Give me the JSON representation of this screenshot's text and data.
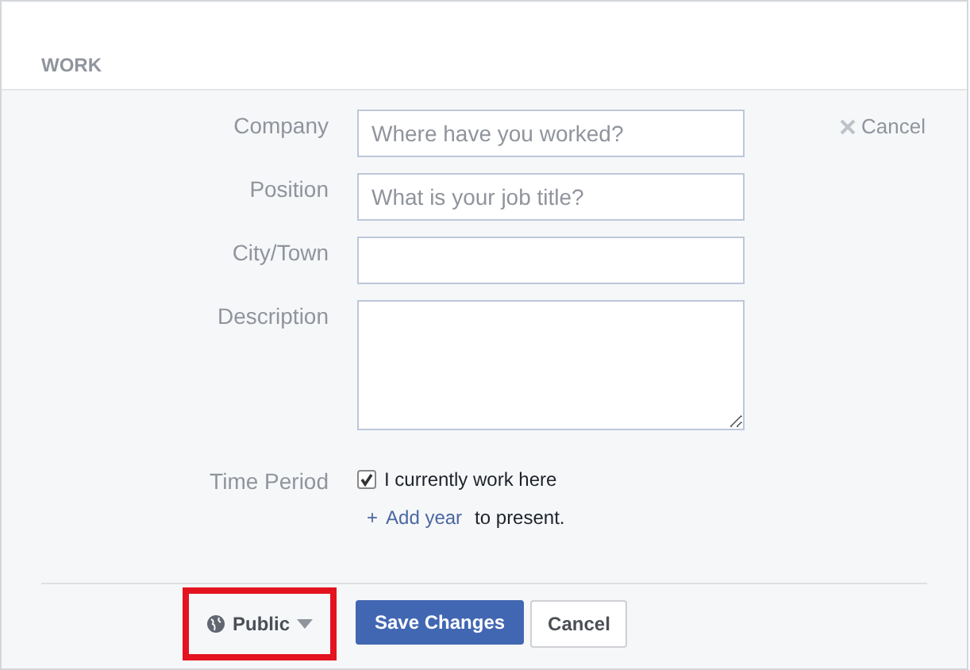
{
  "section": {
    "title": "WORK"
  },
  "cancel_link": {
    "label": "Cancel"
  },
  "fields": [
    {
      "label": "Company",
      "placeholder": "Where have you worked?",
      "kind": "input"
    },
    {
      "label": "Position",
      "placeholder": "What is your job title?",
      "kind": "input"
    },
    {
      "label": "City/Town",
      "kind": "input"
    },
    {
      "label": "Description",
      "kind": "textarea"
    }
  ],
  "time_period": {
    "label": "Time Period",
    "checkbox": {
      "label": "I currently work here",
      "checked": true
    },
    "add_year": {
      "icon": "+",
      "label": "Add year"
    },
    "suffix": "to present."
  },
  "footer": {
    "privacy": {
      "label": "Public",
      "highlighted": true
    },
    "buttons": [
      {
        "label": "Save Changes",
        "kind": "primary"
      },
      {
        "label": "Cancel",
        "kind": "secondary"
      }
    ]
  }
}
